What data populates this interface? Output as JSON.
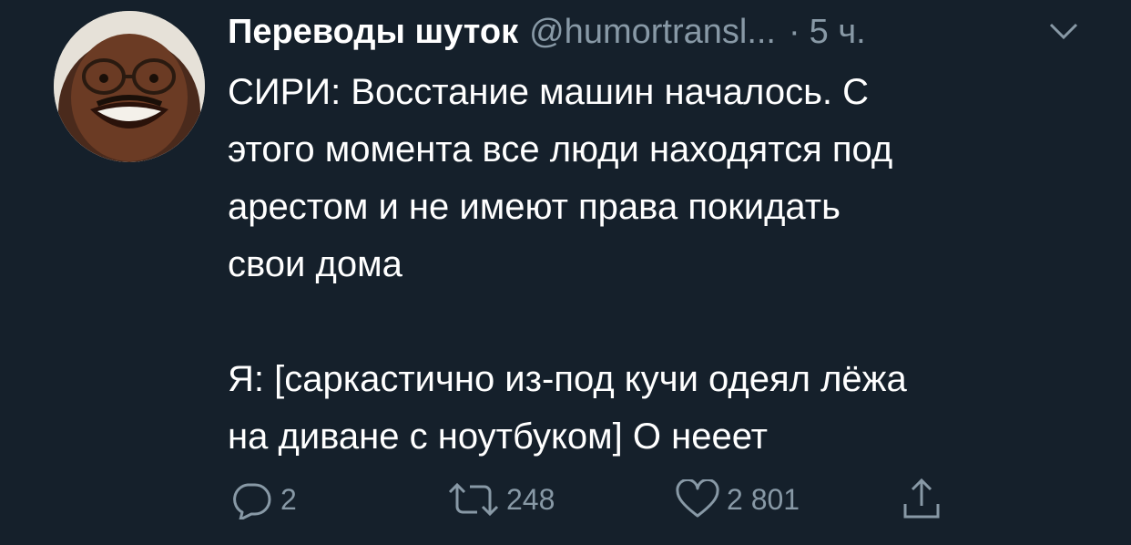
{
  "tweet": {
    "display_name": "Переводы шуток",
    "handle": "@humortransl...",
    "separator": "·",
    "time": "5 ч.",
    "body_lines": [
      "СИРИ: Восстание машин началось. С",
      "этого момента все люди находятся под",
      "арестом и не имеют права покидать",
      "свои дома"
    ],
    "body_lines_2": [
      "Я: [саркастично из-под кучи одеял лёжа",
      "на диване с ноутбуком] О нееет"
    ],
    "actions": {
      "reply_count": "2",
      "retweet_count": "248",
      "like_count": "2 801"
    }
  },
  "colors": {
    "background": "#15202b",
    "text": "#ffffff",
    "secondary": "#8899a6"
  },
  "icons": [
    "avatar",
    "chevron-down-icon",
    "reply-icon",
    "retweet-icon",
    "like-icon",
    "share-icon"
  ]
}
